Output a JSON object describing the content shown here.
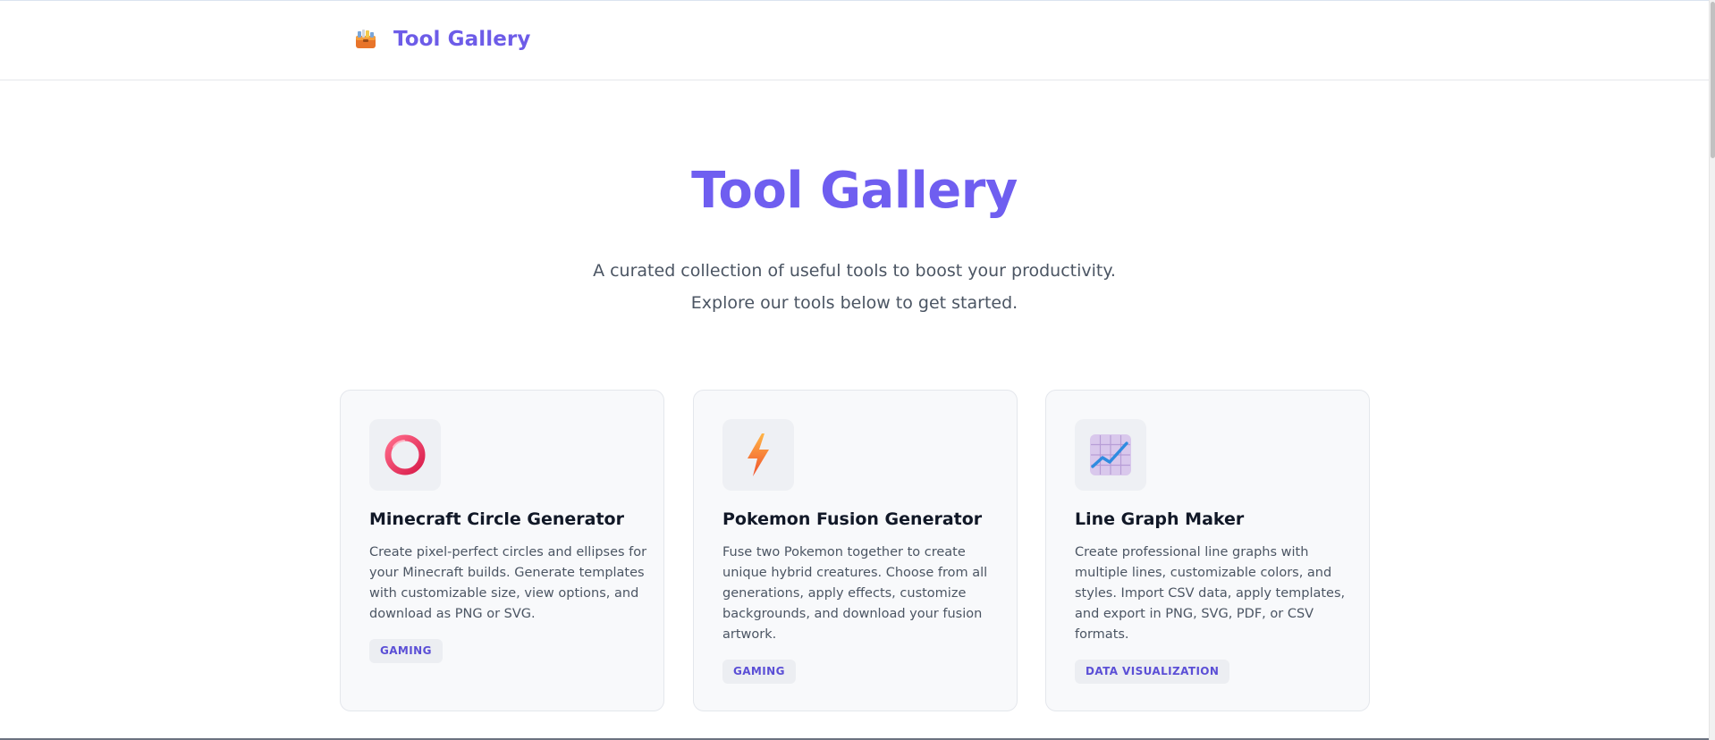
{
  "header": {
    "brand_icon": "toolbox-icon",
    "brand_title": "Tool Gallery"
  },
  "hero": {
    "title": "Tool Gallery",
    "subtitle_line1": "A curated collection of useful tools to boost your productivity.",
    "subtitle_line2": "Explore our tools below to get started."
  },
  "tools": [
    {
      "icon": "ring-icon",
      "title": "Minecraft Circle Generator",
      "description_lines": [
        "Create pixel-perfect circles and ellipses for",
        "your Minecraft builds. Generate templates",
        "with customizable size, view options, and",
        "download as PNG or SVG."
      ],
      "tag": "GAMING"
    },
    {
      "icon": "lightning-icon",
      "title": "Pokemon Fusion Generator",
      "description_lines": [
        "Fuse two Pokemon together to create",
        "unique hybrid creatures. Choose from all",
        "generations, apply effects, customize",
        "backgrounds, and download your fusion",
        "artwork."
      ],
      "tag": "GAMING"
    },
    {
      "icon": "line-chart-icon",
      "title": "Line Graph Maker",
      "description_lines": [
        "Create professional line graphs with",
        "multiple lines, customizable colors, and",
        "styles. Import CSV data, apply templates,",
        "and export in PNG, SVG, PDF, or CSV",
        "formats."
      ],
      "tag": "DATA VISUALIZATION"
    }
  ],
  "colors": {
    "accent": "#6d5ce8",
    "tag_text": "#5b4fd6",
    "card_bg": "#f8f9fb"
  }
}
